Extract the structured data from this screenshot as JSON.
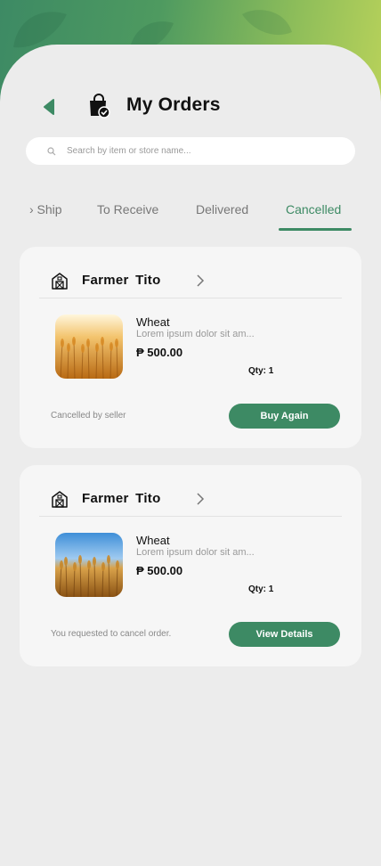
{
  "header": {
    "title": "My Orders"
  },
  "search": {
    "placeholder": "Search by item or store name..."
  },
  "tabs": [
    {
      "label": "› Ship",
      "active": false
    },
    {
      "label": "To Receive",
      "active": false
    },
    {
      "label": "Delivered",
      "active": false
    },
    {
      "label": "Cancelled",
      "active": true
    }
  ],
  "orders": [
    {
      "store": "Farmer  Tito",
      "product": "Wheat",
      "description": "Lorem ipsum dolor sit am...",
      "price": "₱ 500.00",
      "qty": "Qty: 1",
      "status_note": "Cancelled by seller",
      "action_label": "Buy Again",
      "image": "golden-wheat-field-photo"
    },
    {
      "store": "Farmer  Tito",
      "product": "Wheat",
      "description": "Lorem ipsum dolor sit am...",
      "price": "₱ 500.00",
      "qty": "Qty: 1",
      "status_note": "You requested to cancel order.",
      "action_label": "View Details",
      "image": "wheat-blue-sky-photo"
    }
  ],
  "icons": {
    "back": "back-arrow-icon",
    "bag": "shopping-bag-check-icon",
    "search": "search-icon",
    "store": "barn-icon",
    "chevron": "chevron-right-icon"
  },
  "colors": {
    "accent": "#3d8a64",
    "gradient_end": "#b9d25a",
    "background": "#ececec"
  }
}
